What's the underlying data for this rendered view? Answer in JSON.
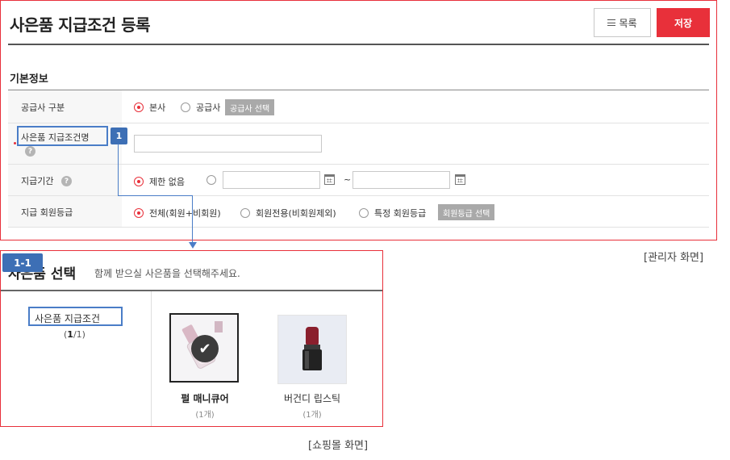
{
  "admin": {
    "title": "사은품 지급조건 등록",
    "list_button": "목록",
    "save_button": "저장",
    "section_title": "기본정보",
    "rows": {
      "supplier": {
        "label": "공급사 구분",
        "options": [
          "본사",
          "공급사"
        ],
        "select_button": "공급사 선택"
      },
      "condition_name": {
        "label": "사은품 지급조건명",
        "value": ""
      },
      "period": {
        "label": "지급기간",
        "option_unlimited": "제한 없음",
        "start_value": "",
        "end_value": "",
        "separator": "~"
      },
      "member_grade": {
        "label": "지급 회원등급",
        "options": [
          "전체(회원+비회원)",
          "회원전용(비회원제외)",
          "특정 회원등급"
        ],
        "select_button": "회원등급 선택"
      }
    }
  },
  "annotations": {
    "badge1": "1",
    "badge1_1": "1-1",
    "admin_caption": "[관리자 화면]",
    "mall_caption": "[쇼핑몰 화면]"
  },
  "mall": {
    "title": "사은품 선택",
    "subtitle": "함께 받으실 사은품을 선택해주세요.",
    "condition_label": "사은품 지급조건",
    "condition_count_current": "1",
    "condition_count_total": "/1)",
    "condition_count_open": "(",
    "products": [
      {
        "name": "펄 매니큐어",
        "count": "(1개)",
        "selected": true
      },
      {
        "name": "버건디 립스틱",
        "count": "(1개)",
        "selected": false
      }
    ]
  },
  "colors": {
    "accent": "#e8303a",
    "annotation_blue": "#3d6fb5",
    "disabled_button": "#a9a9a9"
  },
  "icons": [
    "list-icon",
    "help-icon",
    "calendar-icon",
    "checkmark-icon"
  ]
}
